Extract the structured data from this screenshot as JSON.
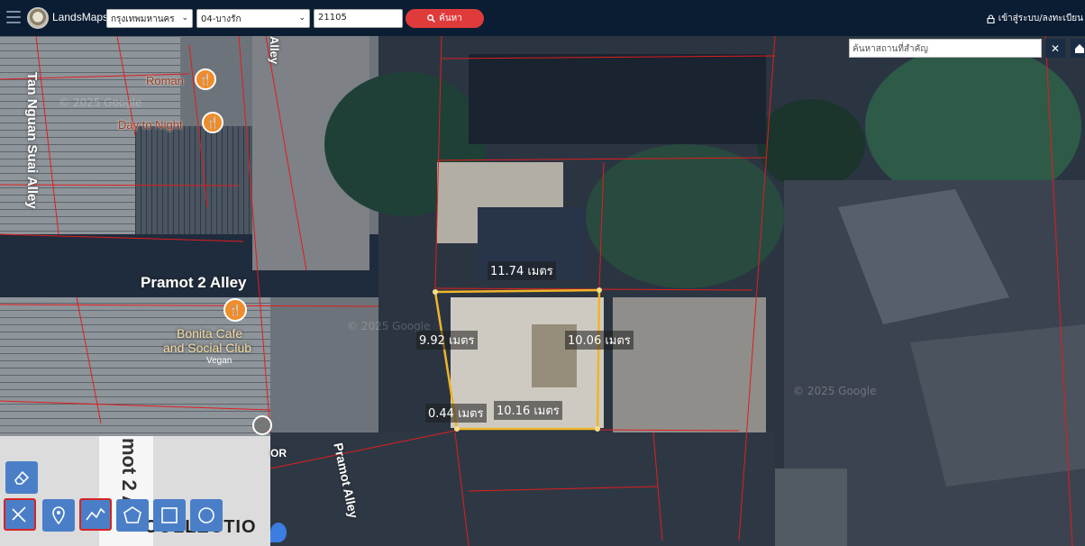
{
  "header": {
    "brand": "LandsMaps",
    "province": "กรุงเทพมหานคร",
    "district": "04-บางรัก",
    "parcel_no": "21105",
    "search_label": "ค้นหา",
    "login_label": "เข้าสู่ระบบ/ลงทะเบียน"
  },
  "map": {
    "place_search_placeholder": "ค้นหาสถานที่สำคัญ",
    "streets": {
      "tan_nguan": "Tan Nguan Suai Alley",
      "pramot2": "Pramot 2 Alley",
      "pramot": "Pramot Alley",
      "alley_top": "Alley",
      "pramot2_vertical": "mot 2 Alle",
      "collection": "COLLECTIO",
      "or_label": "OR"
    },
    "pois": {
      "roman": "Roman",
      "day_to_night": "Day to Night",
      "bonita_line1": "Bonita Cafe",
      "bonita_line2": "and Social Club",
      "bonita_sub": "Vegan"
    },
    "watermarks": [
      "© 2025 Google",
      "© 2025 Google",
      "© 2025 Google"
    ],
    "measurements": {
      "top": "11.74 เมตร",
      "left": "9.92 เมตร",
      "right": "10.06 เมตร",
      "bottom": "10.16 เมตร",
      "short": "0.44 เมตร"
    }
  },
  "tools": [
    "eraser-tool",
    "measure-tool",
    "marker-tool",
    "line-tool",
    "polygon-tool",
    "rectangle-tool",
    "circle-tool"
  ]
}
